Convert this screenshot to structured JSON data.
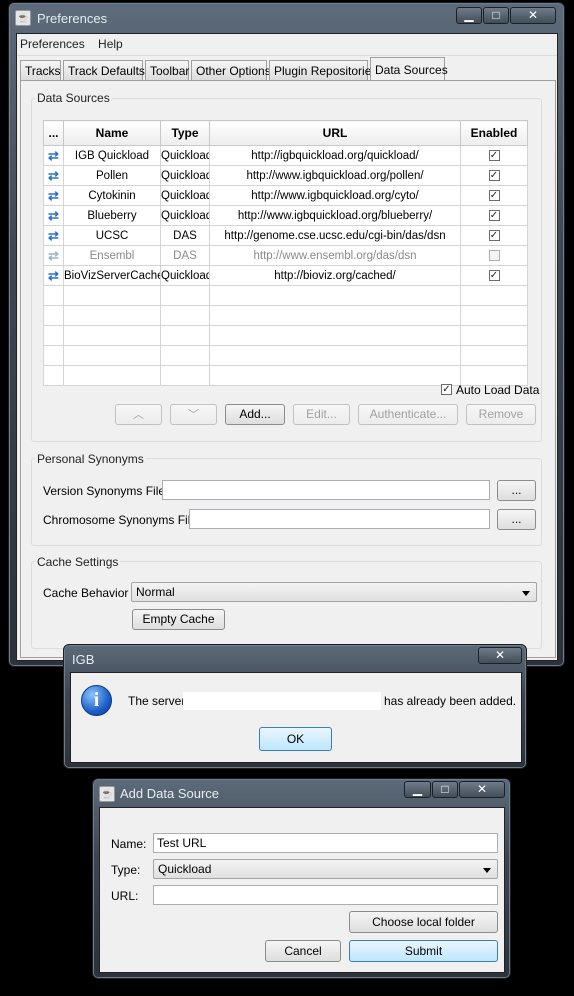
{
  "prefs": {
    "title": "Preferences",
    "menu": [
      "Preferences",
      "Help"
    ],
    "tabs": [
      "Tracks",
      "Track Defaults",
      "Toolbar",
      "Other Options",
      "Plugin Repositories",
      "Data Sources"
    ],
    "active_tab": "Data Sources",
    "data_sources_group": "Data Sources",
    "columns": [
      "...",
      "Name",
      "Type",
      "URL",
      "Enabled"
    ],
    "rows": [
      {
        "name": "IGB Quickload",
        "type": "Quickload",
        "url": "http://igbquickload.org/quickload/",
        "enabled": true,
        "disabled": false
      },
      {
        "name": "Pollen",
        "type": "Quickload",
        "url": "http://www.igbquickload.org/pollen/",
        "enabled": true,
        "disabled": false
      },
      {
        "name": "Cytokinin",
        "type": "Quickload",
        "url": "http://www.igbquickload.org/cyto/",
        "enabled": true,
        "disabled": false
      },
      {
        "name": "Blueberry",
        "type": "Quickload",
        "url": "http://www.igbquickload.org/blueberry/",
        "enabled": true,
        "disabled": false
      },
      {
        "name": "UCSC",
        "type": "DAS",
        "url": "http://genome.cse.ucsc.edu/cgi-bin/das/dsn",
        "enabled": true,
        "disabled": false
      },
      {
        "name": "Ensembl",
        "type": "DAS",
        "url": "http://www.ensembl.org/das/dsn",
        "enabled": false,
        "disabled": true
      },
      {
        "name": "BioVizServerCache",
        "type": "Quickload",
        "url": "http://bioviz.org/cached/",
        "enabled": true,
        "disabled": false
      }
    ],
    "auto_load_label": "Auto Load Data",
    "auto_load_checked": true,
    "buttons": {
      "add": "Add...",
      "edit": "Edit...",
      "authenticate": "Authenticate...",
      "remove": "Remove"
    },
    "synonyms_group": "Personal Synonyms",
    "version_synonyms_label": "Version Synonyms File",
    "chromosome_synonyms_label": "Chromosome Synonyms File",
    "browse_label": "...",
    "cache_group": "Cache Settings",
    "cache_behavior_label": "Cache Behavior",
    "cache_behavior_value": "Normal",
    "empty_cache_label": "Empty Cache"
  },
  "igb_dialog": {
    "title": "IGB",
    "message_prefix": "The server",
    "message_suffix": "has already been added.",
    "ok_label": "OK"
  },
  "add_dialog": {
    "title": "Add Data Source",
    "name_label": "Name:",
    "name_value": "Test URL",
    "type_label": "Type:",
    "type_value": "Quickload",
    "url_label": "URL:",
    "url_value": "",
    "choose_folder_label": "Choose local folder",
    "cancel_label": "Cancel",
    "submit_label": "Submit"
  },
  "window_controls": {
    "minimize": "▁",
    "maximize": "□",
    "close": "✕"
  },
  "colors": {
    "accent_blue": "#2f6fc9",
    "frame": "#3c4652"
  }
}
